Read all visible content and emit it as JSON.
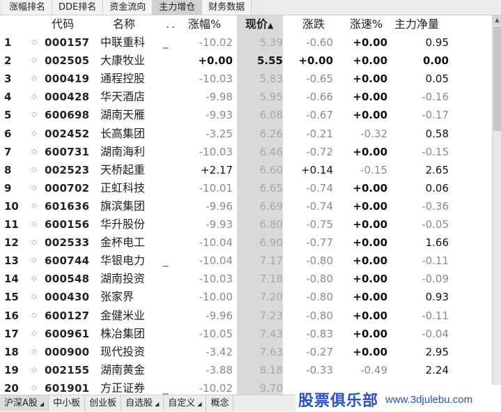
{
  "top_tabs": [
    {
      "label": "涨幅排名",
      "active": false
    },
    {
      "label": "DDE排名",
      "active": false
    },
    {
      "label": "资金流向",
      "active": false
    },
    {
      "label": "主力增仓",
      "active": true
    },
    {
      "label": "财务数据",
      "active": false
    }
  ],
  "table": {
    "headers": {
      "code": "代码",
      "name": "名称",
      "flag": "..",
      "change_pct": "涨幅%",
      "price": "现价",
      "diff": "涨跌",
      "speed_pct": "涨速%",
      "net_inflow": "主力净量"
    },
    "sort_icon": "arrow-up-icon",
    "rows": [
      {
        "num": "1",
        "code": "000157",
        "name": "中联重科",
        "flag": "_",
        "change_pct": "-10.02",
        "price": "5.39",
        "diff": "-0.60",
        "speed_pct": "+0.00",
        "net_inflow": "0.95"
      },
      {
        "num": "2",
        "code": "002505",
        "name": "大康牧业",
        "flag": "",
        "change_pct": "+0.00",
        "price": "5.55",
        "diff": "+0.00",
        "speed_pct": "+0.00",
        "net_inflow": "0.00"
      },
      {
        "num": "3",
        "code": "000419",
        "name": "通程控股",
        "flag": "",
        "change_pct": "-10.03",
        "price": "5.83",
        "diff": "-0.65",
        "speed_pct": "+0.00",
        "net_inflow": "0.05"
      },
      {
        "num": "4",
        "code": "000428",
        "name": "华天酒店",
        "flag": "",
        "change_pct": "-9.98",
        "price": "5.95",
        "diff": "-0.66",
        "speed_pct": "+0.00",
        "net_inflow": "-0.16"
      },
      {
        "num": "5",
        "code": "600698",
        "name": "湖南天雁",
        "flag": "",
        "change_pct": "-9.93",
        "price": "6.08",
        "diff": "-0.67",
        "speed_pct": "+0.00",
        "net_inflow": "-0.17"
      },
      {
        "num": "6",
        "code": "002452",
        "name": "长高集团",
        "flag": "",
        "change_pct": "-3.25",
        "price": "6.26",
        "diff": "-0.21",
        "speed_pct": "-0.32",
        "net_inflow": "0.58"
      },
      {
        "num": "7",
        "code": "600731",
        "name": "湖南海利",
        "flag": "",
        "change_pct": "-10.03",
        "price": "6.46",
        "diff": "-0.72",
        "speed_pct": "+0.00",
        "net_inflow": "-0.15"
      },
      {
        "num": "8",
        "code": "002523",
        "name": "天桥起重",
        "flag": "",
        "change_pct": "+2.17",
        "price": "6.60",
        "diff": "+0.14",
        "speed_pct": "-0.15",
        "net_inflow": "2.65"
      },
      {
        "num": "9",
        "code": "000702",
        "name": "正虹科技",
        "flag": "",
        "change_pct": "-10.01",
        "price": "6.65",
        "diff": "-0.74",
        "speed_pct": "+0.00",
        "net_inflow": "0.06"
      },
      {
        "num": "10",
        "code": "601636",
        "name": "旗滨集团",
        "flag": "",
        "change_pct": "-9.96",
        "price": "6.69",
        "diff": "-0.74",
        "speed_pct": "+0.00",
        "net_inflow": "-0.36"
      },
      {
        "num": "11",
        "code": "600156",
        "name": "华升股份",
        "flag": "",
        "change_pct": "-9.93",
        "price": "6.80",
        "diff": "-0.75",
        "speed_pct": "+0.00",
        "net_inflow": "-0.05"
      },
      {
        "num": "12",
        "code": "002533",
        "name": "金杯电工",
        "flag": "",
        "change_pct": "-10.04",
        "price": "6.90",
        "diff": "-0.77",
        "speed_pct": "+0.00",
        "net_inflow": "1.66"
      },
      {
        "num": "13",
        "code": "600744",
        "name": "华银电力",
        "flag": "_",
        "change_pct": "-10.04",
        "price": "7.17",
        "diff": "-0.80",
        "speed_pct": "+0.00",
        "net_inflow": "-0.11"
      },
      {
        "num": "14",
        "code": "000548",
        "name": "湖南投资",
        "flag": "",
        "change_pct": "-10.03",
        "price": "7.18",
        "diff": "-0.80",
        "speed_pct": "+0.00",
        "net_inflow": "-0.09"
      },
      {
        "num": "15",
        "code": "000430",
        "name": "张家界",
        "flag": "",
        "change_pct": "-10.00",
        "price": "7.20",
        "diff": "-0.80",
        "speed_pct": "+0.00",
        "net_inflow": "0.93"
      },
      {
        "num": "16",
        "code": "600127",
        "name": "金健米业",
        "flag": "",
        "change_pct": "-9.96",
        "price": "7.23",
        "diff": "-0.80",
        "speed_pct": "+0.00",
        "net_inflow": "-0.11"
      },
      {
        "num": "17",
        "code": "600961",
        "name": "株冶集团",
        "flag": "",
        "change_pct": "-10.05",
        "price": "7.43",
        "diff": "-0.83",
        "speed_pct": "+0.00",
        "net_inflow": "-0.04"
      },
      {
        "num": "18",
        "code": "000900",
        "name": "现代投资",
        "flag": "",
        "change_pct": "-3.42",
        "price": "7.63",
        "diff": "-0.27",
        "speed_pct": "+0.00",
        "net_inflow": "2.95"
      },
      {
        "num": "19",
        "code": "002155",
        "name": "湖南黄金",
        "flag": "",
        "change_pct": "-3.88",
        "price": "8.18",
        "diff": "-0.33",
        "speed_pct": "-0.49",
        "net_inflow": "2.24"
      },
      {
        "num": "20",
        "code": "601901",
        "name": "方正证券",
        "flag": "_",
        "change_pct": "-10.02",
        "price": "9.70",
        "diff": "",
        "speed_pct": "",
        "net_inflow": ""
      }
    ]
  },
  "bottom_tabs": [
    {
      "label": "沪深A股",
      "has_menu": true,
      "active": true
    },
    {
      "label": "中小板",
      "has_menu": false,
      "active": false
    },
    {
      "label": "创业板",
      "has_menu": false,
      "active": false
    },
    {
      "label": "自选股",
      "has_menu": true,
      "active": false
    },
    {
      "label": "自定义",
      "has_menu": true,
      "active": false
    },
    {
      "label": "概念",
      "has_menu": false,
      "active": false
    }
  ],
  "watermark": {
    "logo": "股票俱乐部",
    "url": "www.3djulebu.com"
  },
  "colors": {
    "negative": "#8a8a8a",
    "positive": "#111111",
    "price_column_bg": "#d9d9d9",
    "watermark": "#2a4fc2"
  }
}
